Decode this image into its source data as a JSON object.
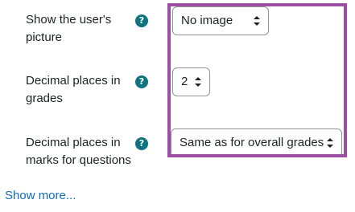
{
  "settings": {
    "show_picture": {
      "label": "Show the user's picture",
      "help_icon": "question-circle-icon",
      "value": "No image"
    },
    "decimal_grades": {
      "label": "Decimal places in grades",
      "help_icon": "question-circle-icon",
      "value": "2"
    },
    "decimal_marks": {
      "label": "Decimal places in marks for questions",
      "help_icon": "question-circle-icon",
      "value": "Same as for overall grades"
    }
  },
  "show_more": "Show more...",
  "colors": {
    "highlight": "#9b4ea3",
    "help_icon": "#0d7480",
    "link": "#0f6cbf"
  }
}
